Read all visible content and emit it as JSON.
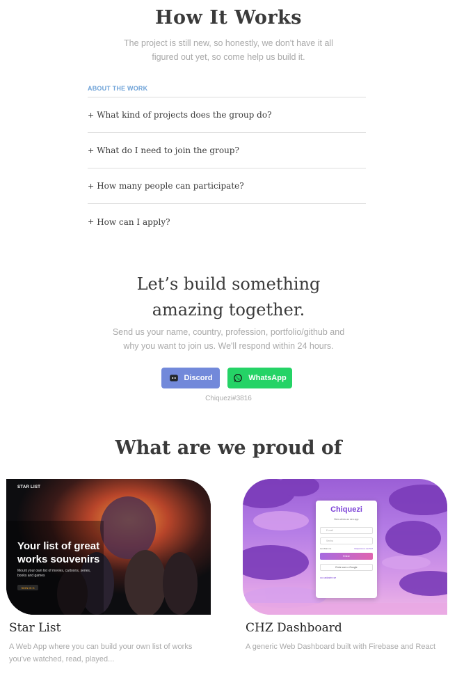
{
  "how_it_works": {
    "title": "How It Works",
    "subtitle": "The project is still new, so honestly, we don't have it all figured out yet, so come help us build it."
  },
  "faq": {
    "header": "ABOUT THE WORK",
    "items": [
      {
        "plus": "+",
        "question": "What kind of projects does the group do?"
      },
      {
        "plus": "+",
        "question": "What do I need to join the group?"
      },
      {
        "plus": "+",
        "question": "How many people can participate?"
      },
      {
        "plus": "+",
        "question": "How can I apply?"
      }
    ]
  },
  "contact": {
    "title_line1": "Let’s build something",
    "title_line2": "amazing together.",
    "subtitle": "Send us your name, country, profession, portfolio/github and why you want to join us. We'll respond within 24 hours.",
    "discord_label": "Discord",
    "whatsapp_label": "WhatsApp",
    "discord_tag": "Chiquezi#3816",
    "discord_color": "#7289da",
    "whatsapp_color": "#25d366"
  },
  "projects": {
    "title": "What are we proud of",
    "items": [
      {
        "title": "Star List",
        "description": "A Web App where you can build your own list of works you've watched, read, played...",
        "image": {
          "label": "STAR LIST",
          "headline_line1": "Your list of great",
          "headline_line2": "works souvenirs",
          "description": "Mount your own list of movies, cartoons, series, books and games",
          "button": "SIGN IN G"
        }
      },
      {
        "title": "CHZ Dashboard",
        "description": "A generic Web Dashboard built with Firebase and React",
        "image": {
          "brand": "Chiquezi",
          "tagline": "Bem-vindo ao seu app",
          "email_placeholder": "E-mail",
          "password_placeholder": "Senha",
          "remember": "Lembrar-me",
          "forgot": "Esqueceu a senha?",
          "enter": "Entrar",
          "google": "Entre com o Google",
          "signup": "ou cadastre-se"
        }
      }
    ]
  }
}
